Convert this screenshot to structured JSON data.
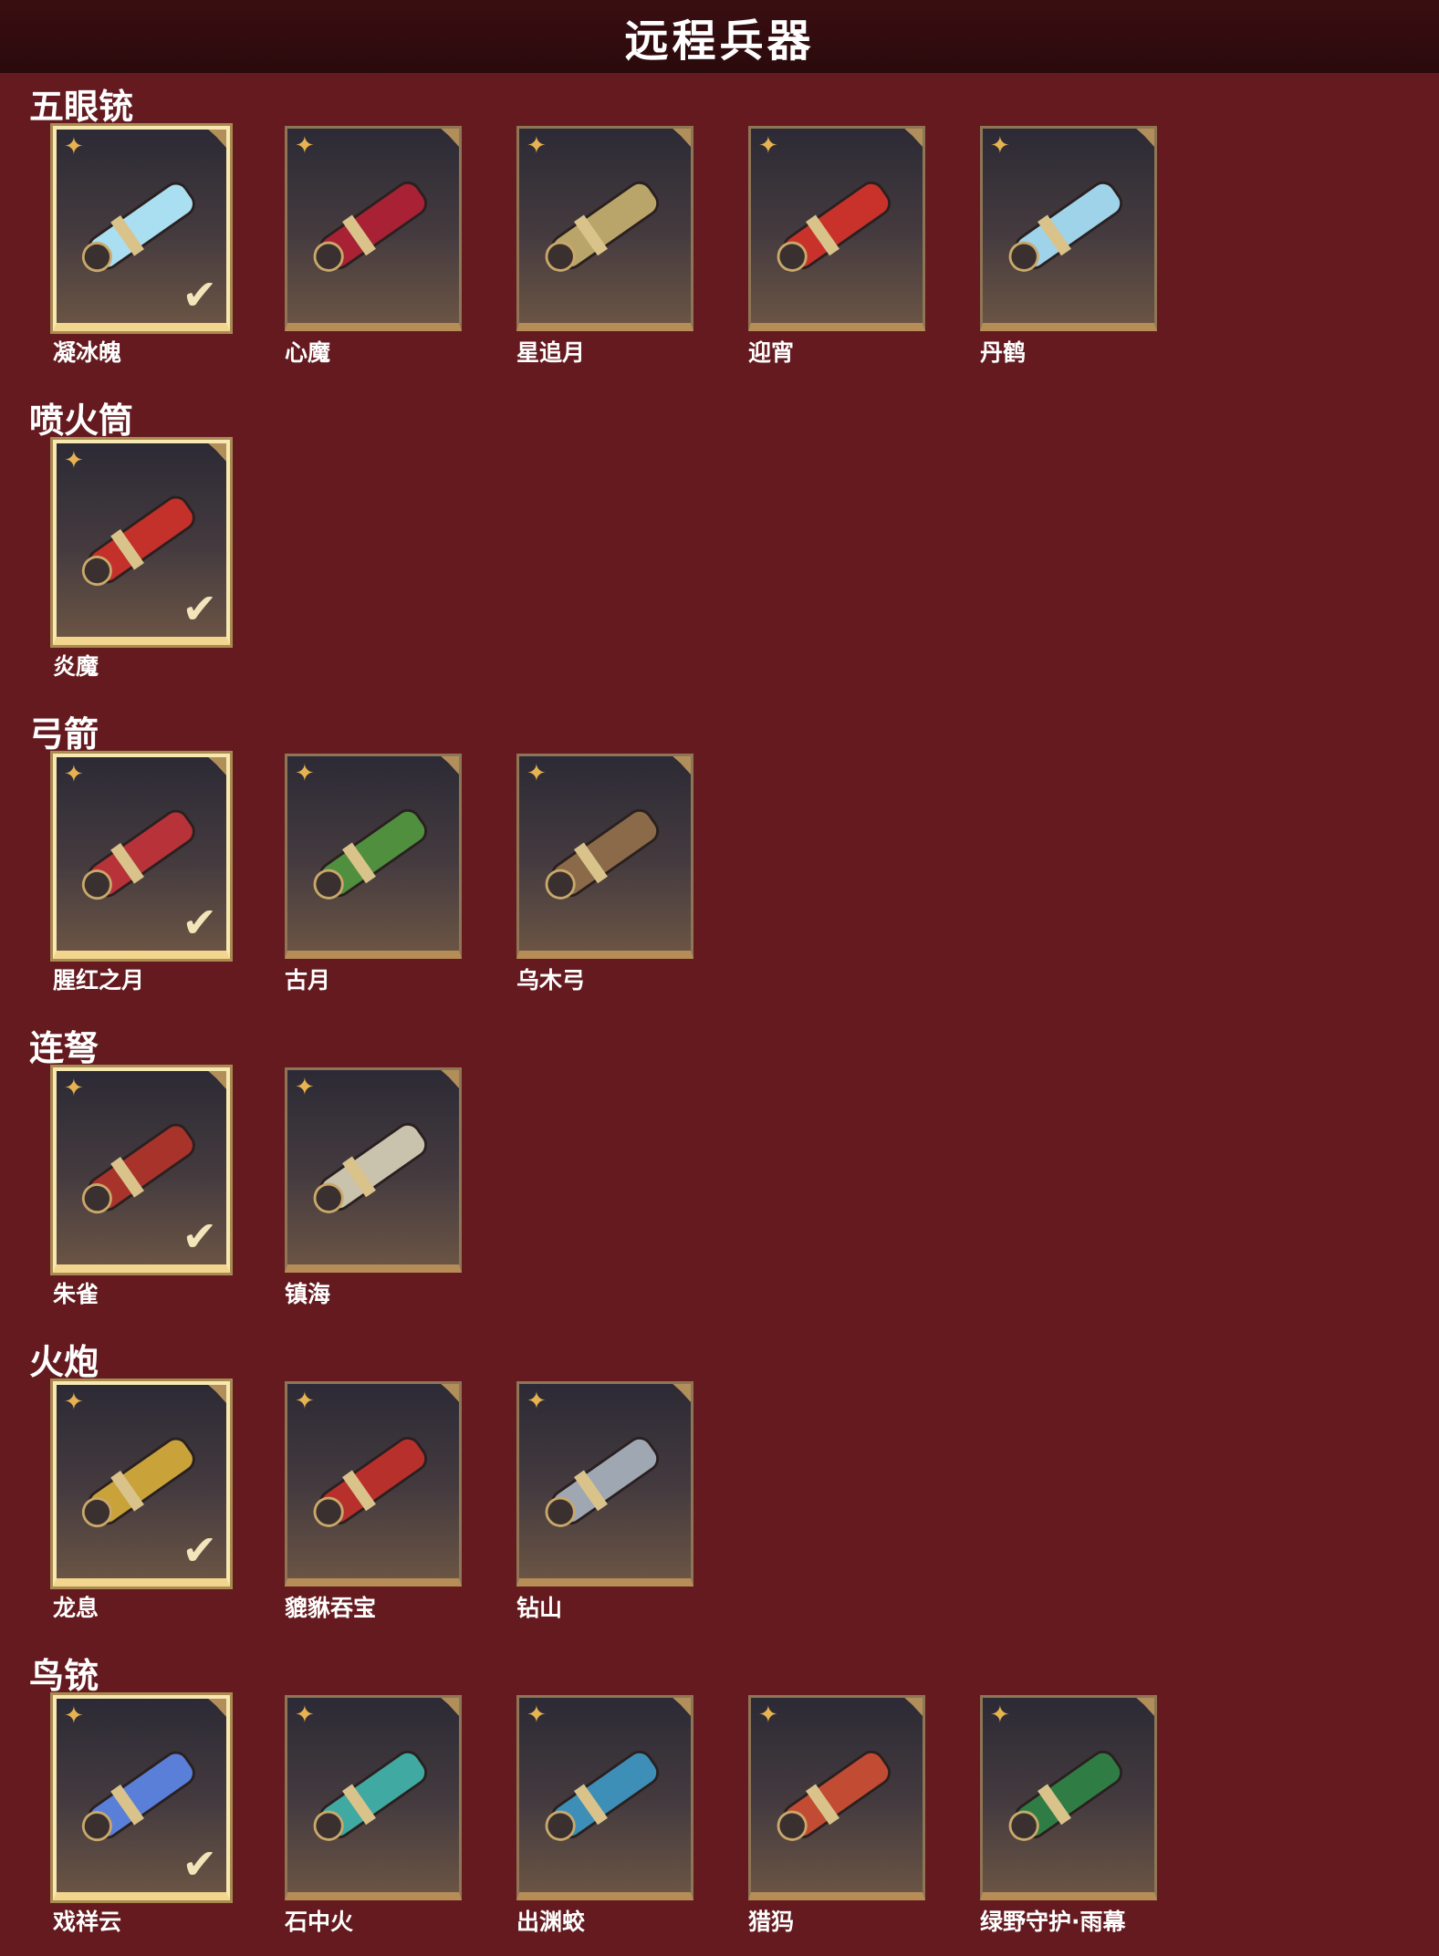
{
  "header": {
    "title": "远程兵器"
  },
  "colors": {
    "background": "#641a1f",
    "header_bar": "#2a0a0c",
    "card_border": "#b68d57",
    "selected_border": "#f7e7b0",
    "rarity_icon": "#e7b250"
  },
  "icons": {
    "rarity": "four-point-star-icon",
    "selected": "check-icon"
  },
  "categories": [
    {
      "name": "五眼铳",
      "items": [
        {
          "name": "凝冰魄",
          "selected": true,
          "accent": "#a9dff0"
        },
        {
          "name": "心魔",
          "selected": false,
          "accent": "#a82134"
        },
        {
          "name": "星追月",
          "selected": false,
          "accent": "#b9a56a"
        },
        {
          "name": "迎宵",
          "selected": false,
          "accent": "#c8322b"
        },
        {
          "name": "丹鹤",
          "selected": false,
          "accent": "#9ed3ea"
        }
      ]
    },
    {
      "name": "喷火筒",
      "items": [
        {
          "name": "炎魔",
          "selected": true,
          "accent": "#c4302a"
        }
      ]
    },
    {
      "name": "弓箭",
      "items": [
        {
          "name": "腥红之月",
          "selected": true,
          "accent": "#b8323a"
        },
        {
          "name": "古月",
          "selected": false,
          "accent": "#4f8f3e"
        },
        {
          "name": "乌木弓",
          "selected": false,
          "accent": "#8a6a48"
        }
      ]
    },
    {
      "name": "连弩",
      "items": [
        {
          "name": "朱雀",
          "selected": true,
          "accent": "#a8332a"
        },
        {
          "name": "镇海",
          "selected": false,
          "accent": "#c9c2ad"
        }
      ]
    },
    {
      "name": "火炮",
      "items": [
        {
          "name": "龙息",
          "selected": true,
          "accent": "#c9a23a"
        },
        {
          "name": "貔貅吞宝",
          "selected": false,
          "accent": "#b8302c"
        },
        {
          "name": "钻山",
          "selected": false,
          "accent": "#9fa7b3"
        }
      ]
    },
    {
      "name": "鸟铳",
      "items": [
        {
          "name": "戏祥云",
          "selected": true,
          "accent": "#5a7fd8"
        },
        {
          "name": "石中火",
          "selected": false,
          "accent": "#3fa9a2"
        },
        {
          "name": "出渊蛟",
          "selected": false,
          "accent": "#3d8fb8"
        },
        {
          "name": "猎犸",
          "selected": false,
          "accent": "#c24b34"
        },
        {
          "name": "绿野守护·雨幕",
          "selected": false,
          "accent": "#2f7d45"
        }
      ]
    }
  ]
}
